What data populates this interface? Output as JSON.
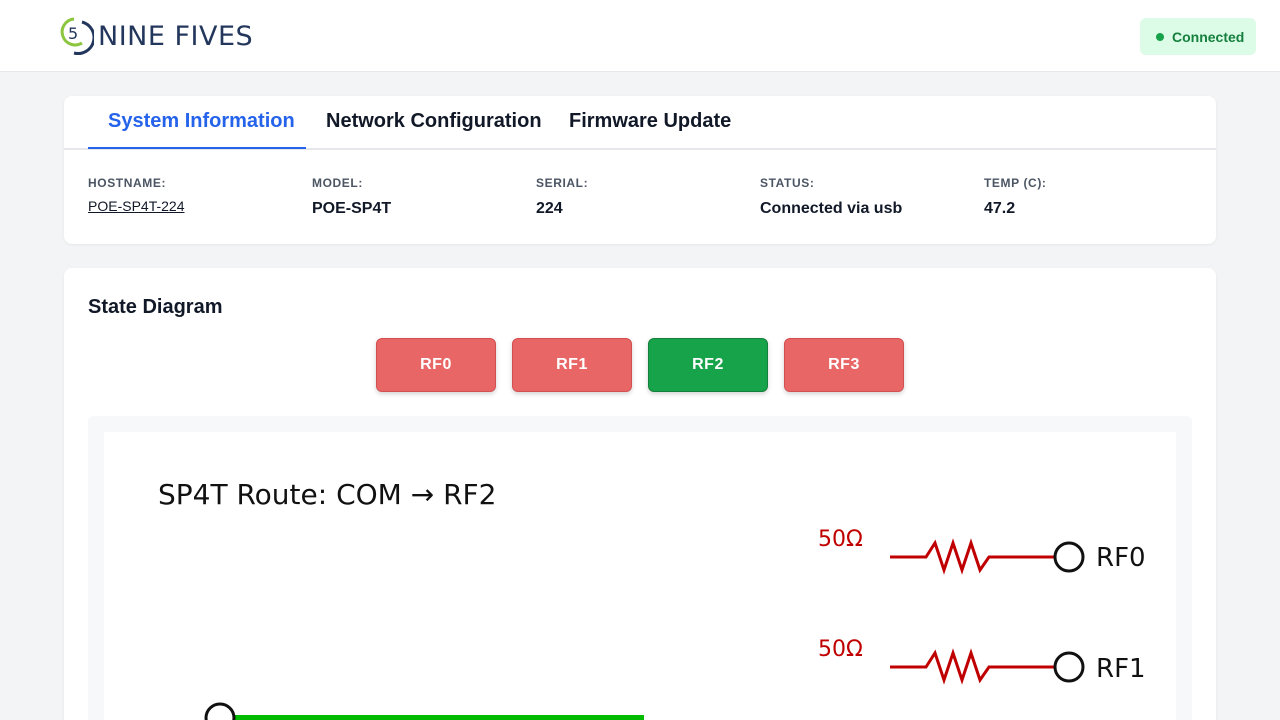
{
  "header": {
    "logo_text": "NINE FIVES",
    "logo_digit": "5",
    "connection_status": "Connected"
  },
  "tabs": [
    {
      "label": "System Information",
      "active": true
    },
    {
      "label": "Network Configuration",
      "active": false
    },
    {
      "label": "Firmware Update",
      "active": false
    }
  ],
  "system_info": {
    "hostname": {
      "label": "HOSTNAME:",
      "value": "POE-SP4T-224"
    },
    "model": {
      "label": "MODEL:",
      "value": "POE-SP4T"
    },
    "serial": {
      "label": "SERIAL:",
      "value": "224"
    },
    "status": {
      "label": "STATUS:",
      "value": "Connected via usb"
    },
    "temp": {
      "label": "TEMP (C):",
      "value": "47.2"
    }
  },
  "state_diagram": {
    "title": "State Diagram",
    "buttons": [
      {
        "label": "RF0",
        "active": false
      },
      {
        "label": "RF1",
        "active": false
      },
      {
        "label": "RF2",
        "active": true
      },
      {
        "label": "RF3",
        "active": false
      }
    ],
    "route_title": "SP4T Route: COM → RF2",
    "ports": [
      {
        "label": "RF0",
        "termination": "50Ω"
      },
      {
        "label": "RF1",
        "termination": "50Ω"
      }
    ]
  },
  "colors": {
    "active_button": "#16a34a",
    "inactive_button": "#e86666",
    "accent": "#2563eb",
    "termination": "#c00000",
    "route_line": "#00bb00"
  },
  "icons": {
    "connection": "status-dot-icon",
    "logo": "nine-fives-logo-icon",
    "resistor": "resistor-icon",
    "port": "port-circle-icon"
  }
}
